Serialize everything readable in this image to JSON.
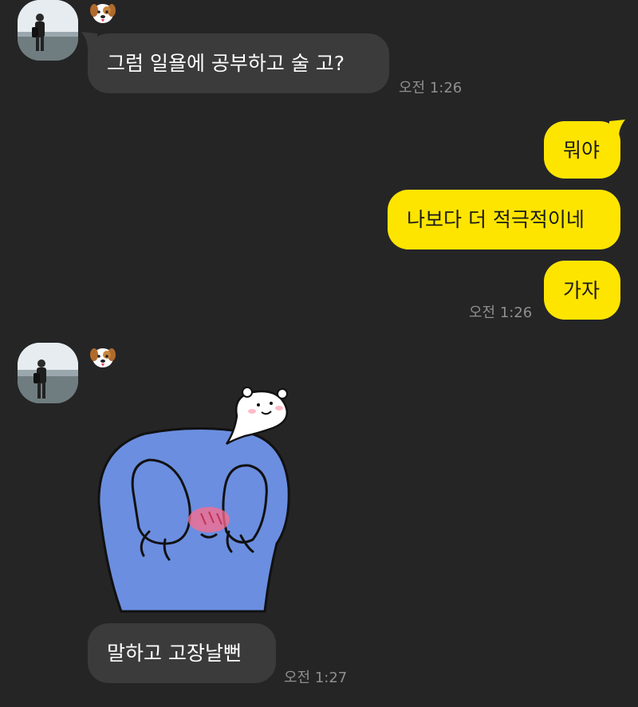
{
  "colors": {
    "background": "#252526",
    "incoming_bubble": "#3b3b3c",
    "outgoing_bubble": "#fee500",
    "timestamp": "#8f8f90"
  },
  "messages": {
    "group1": {
      "sender_icon": "dog-emoji-icon",
      "text": "그럼 일욜에 공부하고 술 고?",
      "time": "오전 1:26"
    },
    "group2": {
      "items": [
        "뭐야",
        "나보다 더 적극적이네",
        "가자"
      ],
      "time": "오전 1:26"
    },
    "group3": {
      "sender_icon": "dog-emoji-icon",
      "sticker": "blue-bear-covering-face-sticker",
      "text": "말하고 고장날뻔",
      "time": "오전 1:27"
    }
  }
}
